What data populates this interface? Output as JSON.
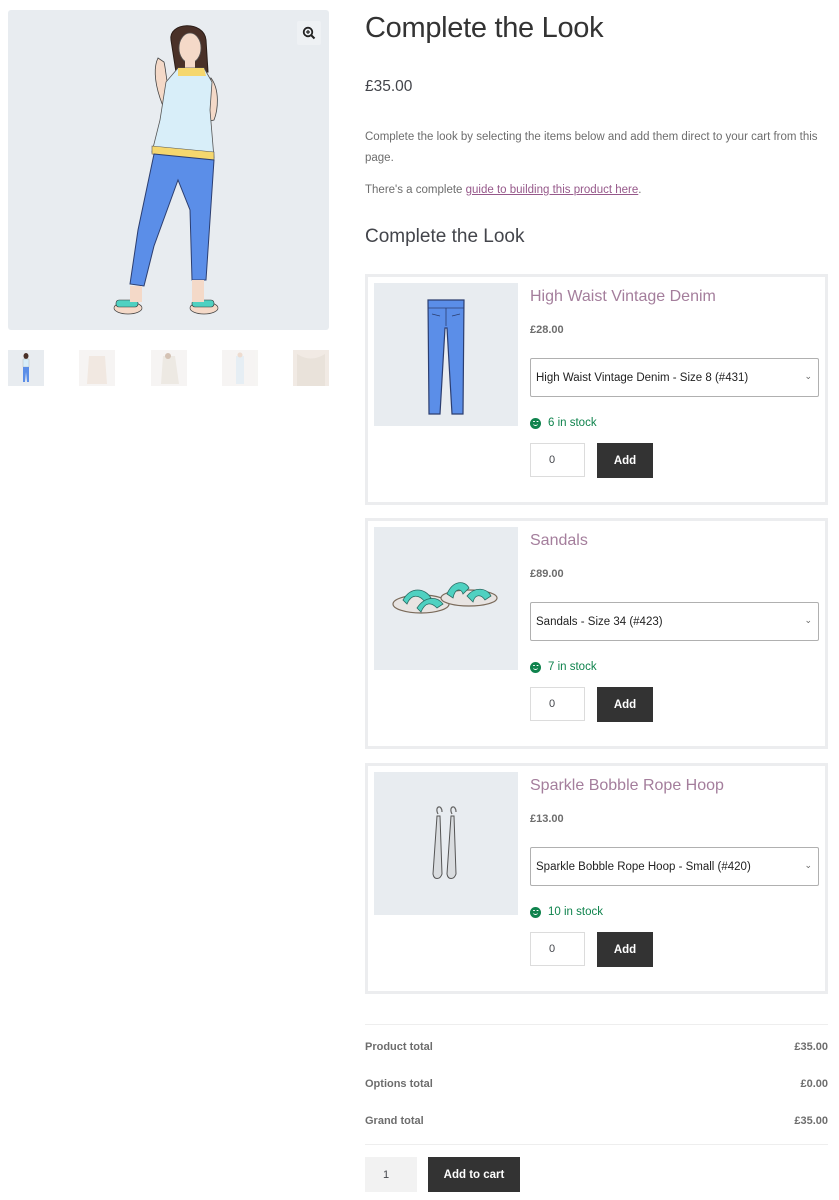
{
  "product": {
    "title": "Complete the Look",
    "price": "£35.00",
    "description": "Complete the look by selecting the items below and add them direct to your cart from this page.",
    "guide_prefix": "There's a complete ",
    "guide_link": "guide to building this product here",
    "guide_suffix": ".",
    "section_title": "Complete the Look"
  },
  "gallery": {
    "zoom_icon": "zoom-in-icon",
    "thumbnails": [
      "outfit-full",
      "top-front",
      "top-side",
      "outfit-light",
      "top-detail"
    ]
  },
  "items": [
    {
      "name": "High Waist Vintage Denim",
      "price": "£28.00",
      "selected_option": "High Waist Vintage Denim - Size 8 (#431)",
      "stock": "6 in stock",
      "quantity": "0",
      "add_label": "Add",
      "image": "jeans"
    },
    {
      "name": "Sandals",
      "price": "£89.00",
      "selected_option": "Sandals - Size 34 (#423)",
      "stock": "7 in stock",
      "quantity": "0",
      "add_label": "Add",
      "image": "sandals"
    },
    {
      "name": "Sparkle Bobble Rope Hoop",
      "price": "£13.00",
      "selected_option": "Sparkle Bobble Rope Hoop - Small (#420)",
      "stock": "10 in stock",
      "quantity": "0",
      "add_label": "Add",
      "image": "earrings"
    }
  ],
  "totals": {
    "product_total_label": "Product total",
    "product_total_value": "£35.00",
    "options_total_label": "Options total",
    "options_total_value": "£0.00",
    "grand_total_label": "Grand total",
    "grand_total_value": "£35.00"
  },
  "cart": {
    "quantity": "1",
    "add_to_cart_label": "Add to cart"
  },
  "colors": {
    "accent_link": "#96588a",
    "item_title": "#a47e9c",
    "in_stock": "#0f834d",
    "button_bg": "#333333"
  }
}
